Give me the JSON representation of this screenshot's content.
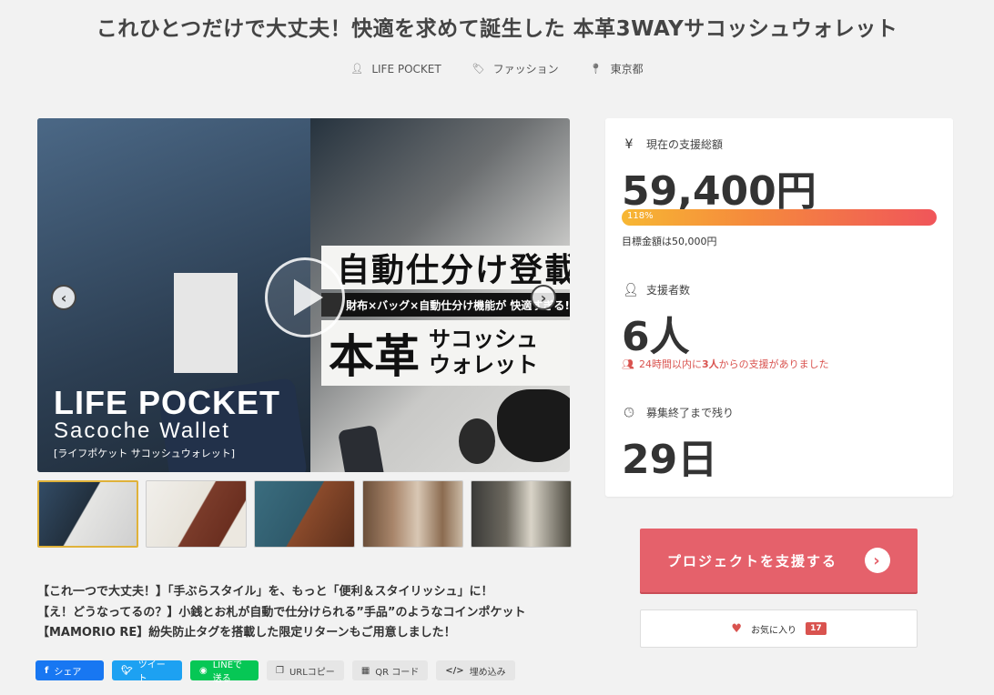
{
  "project": {
    "title": "これひとつだけで大丈夫！快適を求めて誕生した 本革3WAYサコッシュウォレット",
    "owner": "LIFE POCKET",
    "category": "ファッション",
    "location": "東京都"
  },
  "hero": {
    "headline": "自動仕分け登載",
    "subline": "財布×バッグ×自動仕分け機能が 快適すぎる!",
    "big_text": "本革",
    "side_text_1": "サコッシュ",
    "side_text_2": "ウォレット",
    "logo_line1": "LIFE POCKET",
    "logo_line2": "Sacoche Wallet",
    "logo_line3": "[ライフポケット サコッシュウォレット]"
  },
  "description": [
    "【これ一つで大丈夫！】「手ぶらスタイル」を、もっと「便利＆スタイリッシュ」に！",
    "【え！どうなってるの？】小銭とお札が自動で仕分けられる”手品”のようなコインポケット",
    "【MAMORIO RE】紛失防止タグを搭載した限定リターンもご用意しました！"
  ],
  "share": {
    "facebook": "シェア",
    "twitter": "ツイート",
    "line": "LINEで送る",
    "url_copy": "URLコピー",
    "qr": "QR コード",
    "embed": "埋め込み"
  },
  "stats": {
    "total_label": "現在の支援総額",
    "total_value": "59,400円",
    "progress_percent": 118,
    "progress_label": "118%",
    "goal_text": "目標金額は50,000円",
    "backers_label": "支援者数",
    "backers_value": "6人",
    "recent_prefix": "24時間以内に",
    "recent_count": "3人",
    "recent_suffix": "からの支援がありました",
    "remaining_label": "募集終了まで残り",
    "remaining_value": "29日"
  },
  "actions": {
    "support": "プロジェクトを支援する",
    "favorite": "お気に入り",
    "favorite_count": "17"
  },
  "colors": {
    "support_button": "#e5616b",
    "progress_start": "#f7b733",
    "progress_end": "#f0555a",
    "alert_red": "#d9534f"
  }
}
